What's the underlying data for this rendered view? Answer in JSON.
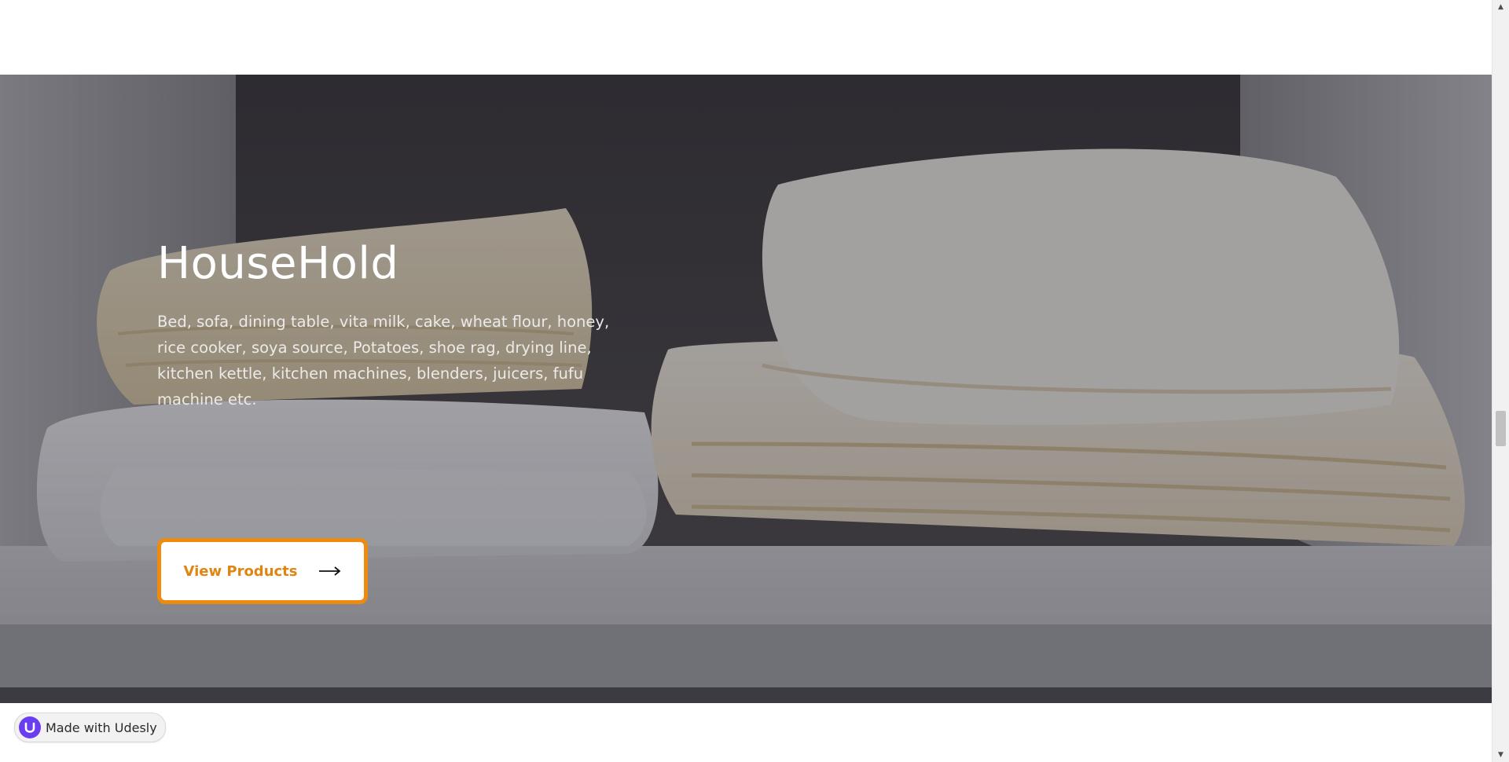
{
  "hero": {
    "title": "HouseHold",
    "description": "Bed, sofa, dining table, vita milk, cake, wheat flour, honey, rice cooker, soya source, Potatoes, shoe rag, drying line, kitchen kettle, kitchen machines, blenders, juicers, fufu machine etc.",
    "cta_label": "View Products",
    "background_image": "folded-towels-on-shelf",
    "accent_color": "#ee8a0e"
  },
  "badge": {
    "label": "Made with Udesly",
    "icon": "udesly-logo-icon",
    "color": "#6a3df0"
  },
  "scrollbar": {
    "up_icon": "▲",
    "down_icon": "▼"
  }
}
